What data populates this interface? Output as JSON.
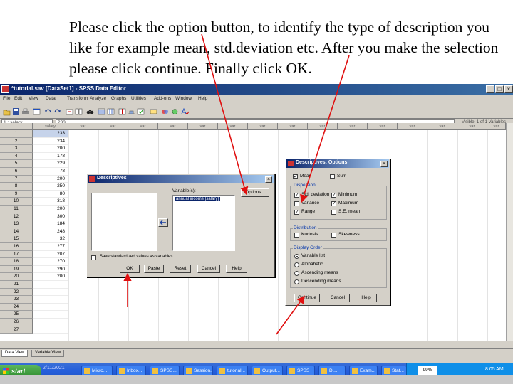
{
  "instruction": {
    "text": "Please click the option button, to identify the type of description you like for example mean, std.deviation etc. After you make the selection please click continue. Finally click OK."
  },
  "window": {
    "title": "*tutorial.sav [DataSet1] - SPSS Data Editor",
    "menus": [
      "File",
      "Edit",
      "View",
      "Data",
      "Transform",
      "Analyze",
      "Graphs",
      "Utilities",
      "Add-ons",
      "Window",
      "Help"
    ],
    "minimize": "_",
    "maximize": "□",
    "close": "×"
  },
  "formula": {
    "cell_ref": "1 : salary",
    "cell_value": "233",
    "visible_vars": "Visible: 1 of 1 Variables"
  },
  "grid": {
    "var_name": "salary",
    "col_label": "var",
    "rows": [
      {
        "n": "1",
        "v": "233"
      },
      {
        "n": "2",
        "v": "234"
      },
      {
        "n": "3",
        "v": "200"
      },
      {
        "n": "4",
        "v": "178"
      },
      {
        "n": "5",
        "v": "229"
      },
      {
        "n": "6",
        "v": "78"
      },
      {
        "n": "7",
        "v": "200"
      },
      {
        "n": "8",
        "v": "250"
      },
      {
        "n": "9",
        "v": "80"
      },
      {
        "n": "10",
        "v": "318"
      },
      {
        "n": "11",
        "v": "200"
      },
      {
        "n": "12",
        "v": "300"
      },
      {
        "n": "13",
        "v": "184"
      },
      {
        "n": "14",
        "v": "248"
      },
      {
        "n": "15",
        "v": "32"
      },
      {
        "n": "16",
        "v": "277"
      },
      {
        "n": "17",
        "v": "207"
      },
      {
        "n": "18",
        "v": "270"
      },
      {
        "n": "19",
        "v": "290"
      },
      {
        "n": "20",
        "v": "200"
      },
      {
        "n": "21",
        "v": ""
      },
      {
        "n": "22",
        "v": ""
      },
      {
        "n": "23",
        "v": ""
      },
      {
        "n": "24",
        "v": ""
      },
      {
        "n": "25",
        "v": ""
      },
      {
        "n": "26",
        "v": ""
      },
      {
        "n": "27",
        "v": ""
      }
    ]
  },
  "tabs": {
    "data_view": "Data View",
    "variable_view": "Variable View"
  },
  "descriptives": {
    "title": "Descriptives",
    "variables_label": "Variable(s):",
    "variable_item": "annual income [salary]",
    "options_button": "Options...",
    "save_checkbox": "Save standardized values as variables",
    "buttons": {
      "ok": "OK",
      "paste": "Paste",
      "reset": "Reset",
      "cancel": "Cancel",
      "help": "Help"
    }
  },
  "options_dialog": {
    "title": "Descriptives: Options",
    "mean": "Mean",
    "sum": "Sum",
    "dispersion_label": "Dispersion",
    "std_deviation": "Std. deviation",
    "minimum": "Minimum",
    "variance": "Variance",
    "maximum": "Maximum",
    "range": "Range",
    "se_mean": "S.E. mean",
    "distribution_label": "Distribution",
    "kurtosis": "Kurtosis",
    "skewness": "Skewness",
    "display_order_label": "Display Order",
    "order_variable_list": "Variable list",
    "order_alphabetic": "Alphabetic",
    "order_ascending": "Ascending means",
    "order_descending": "Descending means",
    "continue_button": "Continue",
    "cancel_button": "Cancel",
    "help_button": "Help"
  },
  "taskbar": {
    "start": "start",
    "footer_date": "2/11/2021",
    "tasks": [
      "Micro...",
      "Inbox...",
      "SPSS...",
      "Session...",
      "tutorial...",
      "Output...",
      "SPSS",
      "Di...",
      "Exam...",
      "Stat..."
    ],
    "zoom": "99%",
    "clock": "8:05 AM"
  }
}
